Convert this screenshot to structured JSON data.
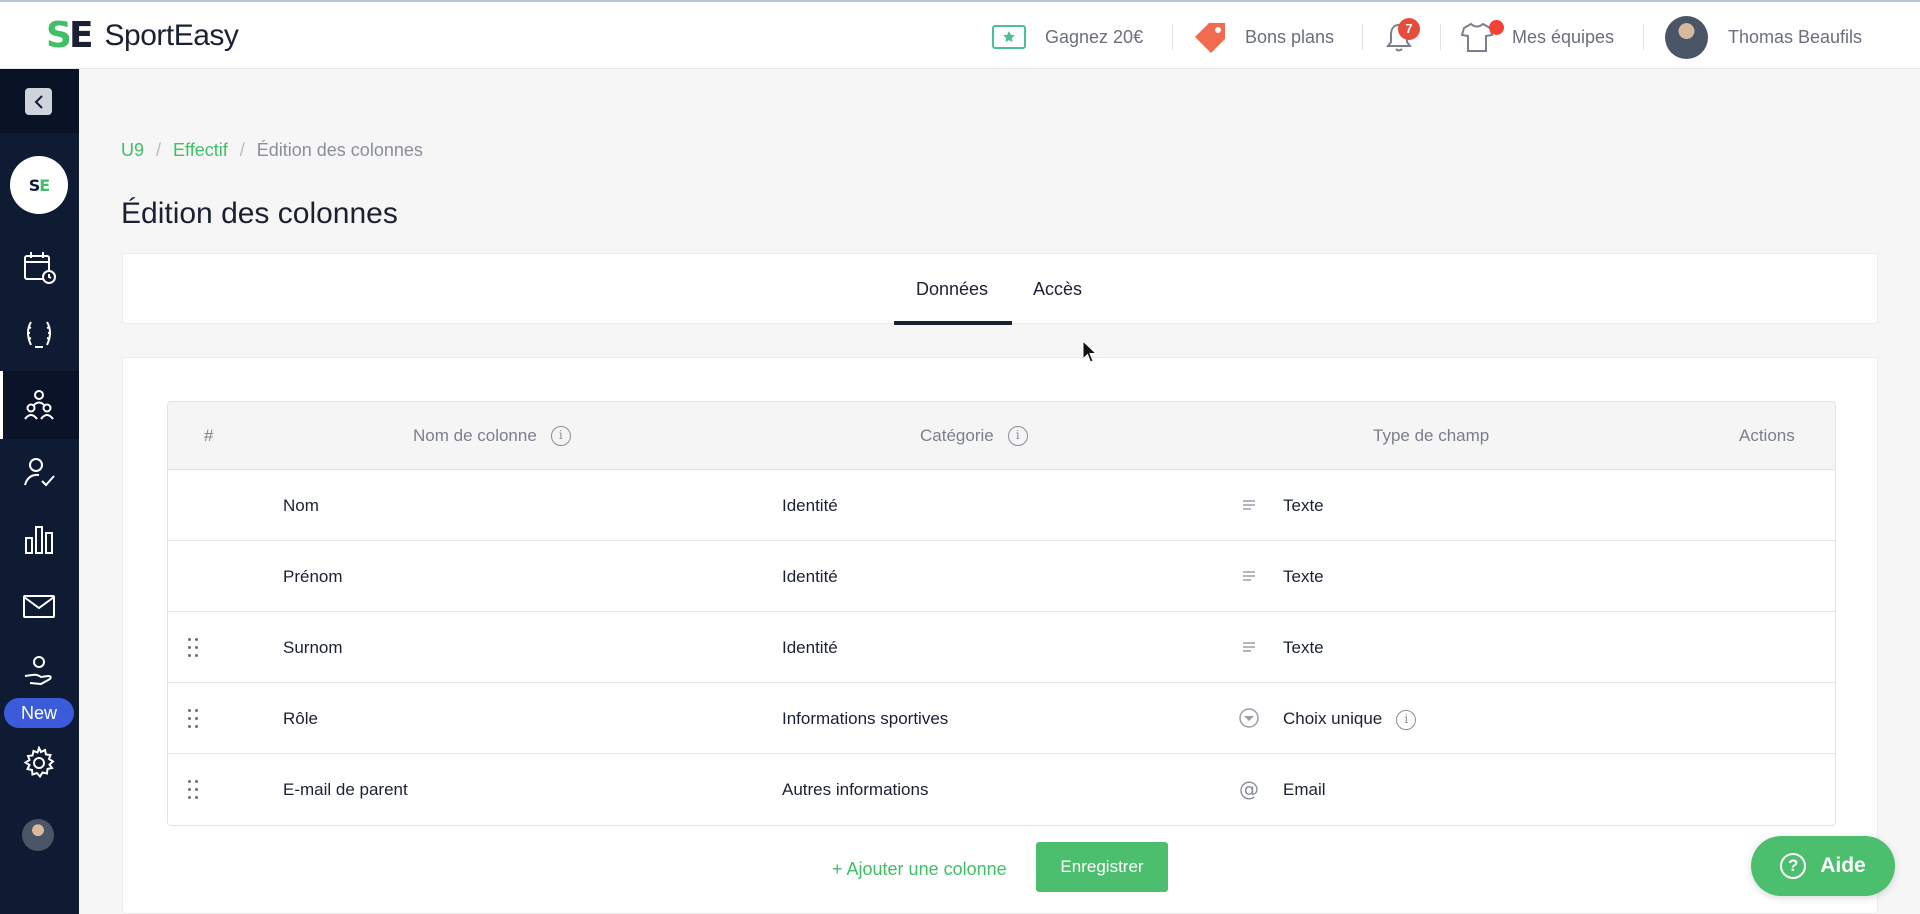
{
  "app": {
    "name": "SportEasy",
    "logo_mark_s": "S",
    "logo_mark_e": "E"
  },
  "topbar": {
    "referral_label": "Gagnez 20€",
    "deals_label": "Bons plans",
    "notifications_count": "7",
    "teams_label": "Mes équipes",
    "user_name": "Thomas Beaufils"
  },
  "sidebar": {
    "club_logo_s": "S",
    "club_logo_e": "E",
    "new_badge": "New",
    "items": [
      {
        "name": "calendar-icon"
      },
      {
        "name": "laurel-icon"
      },
      {
        "name": "team-icon",
        "active": true
      },
      {
        "name": "user-check-icon"
      },
      {
        "name": "stats-icon"
      },
      {
        "name": "mail-icon"
      },
      {
        "name": "hand-heart-icon"
      },
      {
        "name": "gear-icon"
      }
    ]
  },
  "breadcrumb": {
    "items": [
      "U9",
      "Effectif",
      "Édition des colonnes"
    ],
    "separator": "/"
  },
  "page": {
    "title": "Édition des colonnes"
  },
  "tabs": [
    {
      "label": "Données",
      "active": true
    },
    {
      "label": "Accès",
      "active": false
    }
  ],
  "table": {
    "headers": {
      "index": "#",
      "name": "Nom de colonne",
      "category": "Catégorie",
      "type": "Type de champ",
      "actions": "Actions"
    },
    "rows": [
      {
        "name": "Nom",
        "category": "Identité",
        "type_icon": "lines-icon",
        "type": "Texte",
        "draggable": false
      },
      {
        "name": "Prénom",
        "category": "Identité",
        "type_icon": "lines-icon",
        "type": "Texte",
        "draggable": false
      },
      {
        "name": "Surnom",
        "category": "Identité",
        "type_icon": "lines-icon",
        "type": "Texte",
        "draggable": true
      },
      {
        "name": "Rôle",
        "category": "Informations sportives",
        "type_icon": "dropdown-icon",
        "type": "Choix unique",
        "draggable": true,
        "info": true
      },
      {
        "name": "E-mail de parent",
        "category": "Autres informations",
        "type_icon": "at-icon",
        "type": "Email",
        "draggable": true
      }
    ]
  },
  "actions": {
    "add_column": "+ Ajouter une colonne",
    "save": "Enregistrer"
  },
  "help": {
    "label": "Aide"
  },
  "colors": {
    "brand_green": "#3fbf66",
    "sidebar_bg": "#0f1a33",
    "new_badge": "#3b5bdb",
    "notification": "#e74c3c"
  }
}
